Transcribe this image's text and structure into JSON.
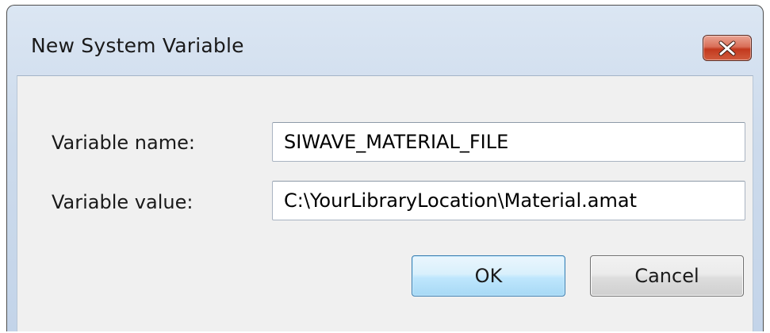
{
  "dialog": {
    "title": "New System Variable",
    "close_icon": "close-x-icon"
  },
  "form": {
    "variable_name_label": "Variable name:",
    "variable_name_value": "SIWAVE_MATERIAL_FILE",
    "variable_value_label": "Variable value:",
    "variable_value_value": "C:\\YourLibraryLocation\\Material.amat"
  },
  "buttons": {
    "ok_label": "OK",
    "cancel_label": "Cancel"
  },
  "colors": {
    "close_button": "#c2391e",
    "ok_border": "#3c7fb1",
    "titlebar": "#cddbec"
  }
}
